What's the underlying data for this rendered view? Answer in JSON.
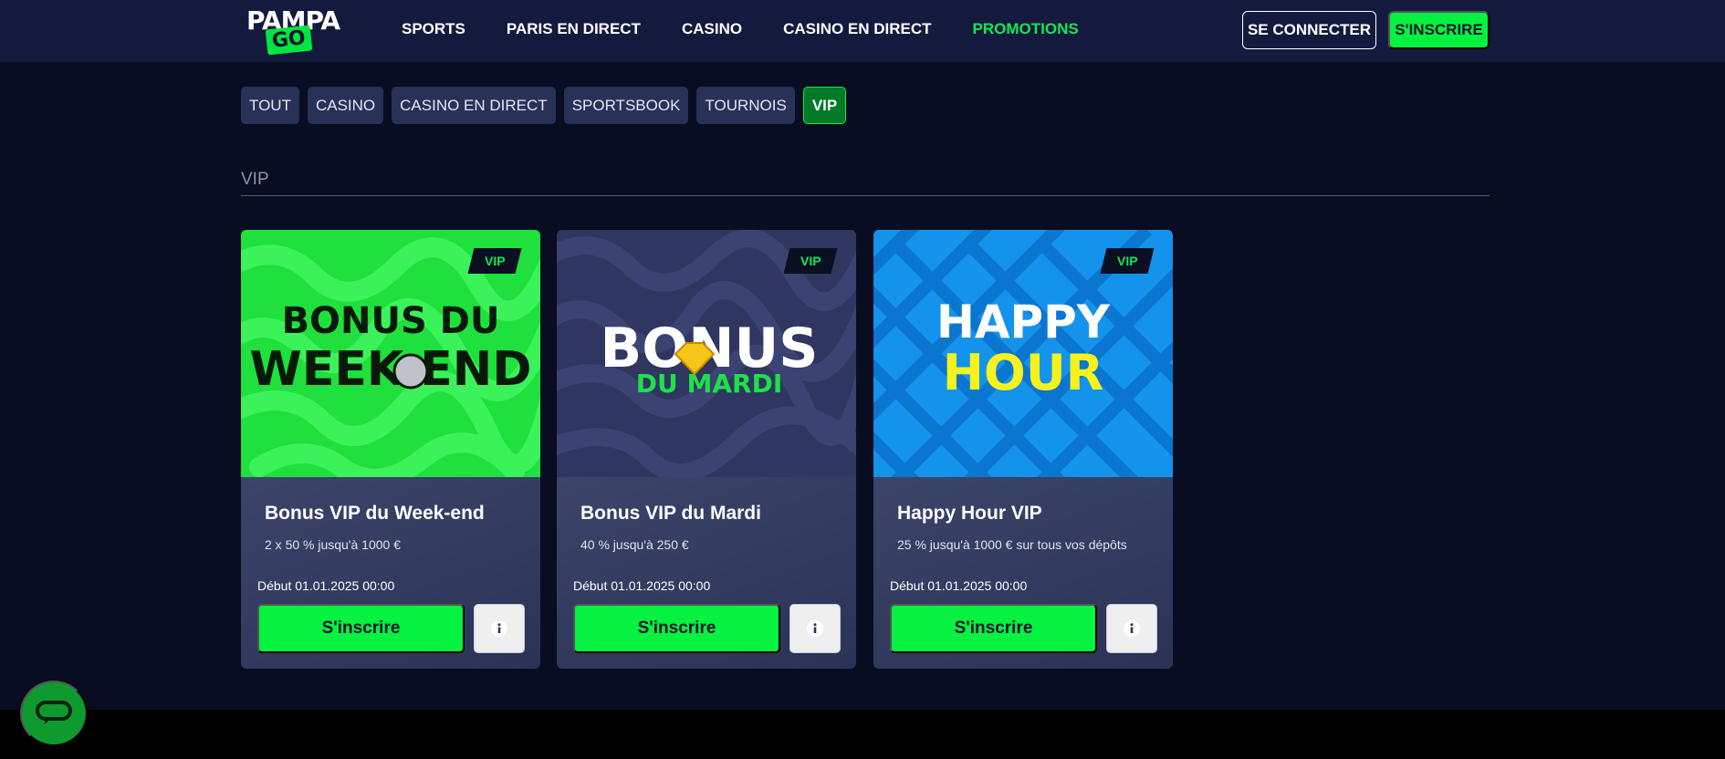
{
  "header": {
    "logo_top": "PAMPA",
    "logo_bottom": "GO",
    "nav": [
      {
        "label": "SPORTS",
        "active": false
      },
      {
        "label": "PARIS EN DIRECT",
        "active": false
      },
      {
        "label": "CASINO",
        "active": false
      },
      {
        "label": "CASINO EN DIRECT",
        "active": false
      },
      {
        "label": "PROMOTIONS",
        "active": true
      }
    ],
    "login_label": "SE CONNECTER",
    "register_label": "S'INSCRIRE"
  },
  "filters": [
    {
      "label": "TOUT",
      "active": false
    },
    {
      "label": "CASINO",
      "active": false
    },
    {
      "label": "CASINO EN DIRECT",
      "active": false
    },
    {
      "label": "SPORTSBOOK",
      "active": false
    },
    {
      "label": "TOURNOIS",
      "active": false
    },
    {
      "label": "VIP",
      "active": true
    }
  ],
  "section": {
    "title": "VIP"
  },
  "cards": [
    {
      "badge": "VIP",
      "art_line1": "BONUS DU",
      "art_line2": "WEEK END",
      "title": "Bonus VIP du Week-end",
      "subtitle": "2 x 50 % jusqu'à 1000 €",
      "date": "Début 01.01.2025 00:00",
      "cta": "S'inscrire",
      "theme": "green"
    },
    {
      "badge": "VIP",
      "art_line1": "BONUS",
      "art_line2": "DU MARDI",
      "title": "Bonus VIP du Mardi",
      "subtitle": "40 % jusqu'à 250 €",
      "date": "Début 01.01.2025 00:00",
      "cta": "S'inscrire",
      "theme": "navy"
    },
    {
      "badge": "VIP",
      "art_line1": "HAPPY",
      "art_line2": "HOUR",
      "title": "Happy Hour VIP",
      "subtitle": "25 % jusqu'à 1000 € sur tous vos dépôts",
      "date": "Début 01.01.2025 00:00",
      "cta": "S'inscrire",
      "theme": "blue"
    }
  ],
  "colors": {
    "accent": "#05f240",
    "header_bg": "#141a3e",
    "page_bg": "#090d21",
    "chip_bg": "#283157"
  },
  "icons": {
    "info": "info-icon",
    "chat": "chat-bubble-icon"
  }
}
